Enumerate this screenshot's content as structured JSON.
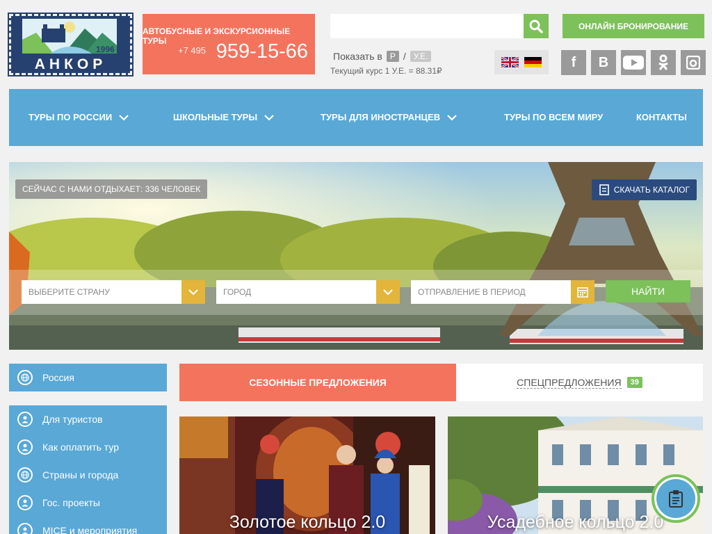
{
  "header": {
    "logo": {
      "brand": "АНКОР",
      "year": "1996"
    },
    "phone": {
      "tagline": "АВТОБУСНЫЕ И ЭКСКУРСИОННЫЕ ТУРЫ",
      "prefix": "+7 495",
      "number": "959-15-66"
    },
    "search": {
      "placeholder": ""
    },
    "currency": {
      "label": "Показать в",
      "options": [
        "Р",
        "У.Е."
      ],
      "separator": "/",
      "rate_text": "Текущий курс 1 У.Е. = 88.31₽"
    },
    "booking_button": "ОНЛАЙН БРОНИРОВАНИЕ",
    "languages": [
      "en",
      "de"
    ],
    "socials": [
      {
        "icon": "facebook-icon",
        "glyph": "f"
      },
      {
        "icon": "vkontakte-icon",
        "glyph": "В"
      },
      {
        "icon": "youtube-icon",
        "glyph": ""
      },
      {
        "icon": "odnoklassniki-icon",
        "glyph": ""
      },
      {
        "icon": "instagram-icon",
        "glyph": ""
      }
    ]
  },
  "nav": {
    "items": [
      {
        "label": "ТУРЫ ПО РОССИИ",
        "dropdown": true
      },
      {
        "label": "ШКОЛЬНЫЕ ТУРЫ",
        "dropdown": true
      },
      {
        "label": "ТУРЫ ДЛЯ ИНОСТРАНЦЕВ",
        "dropdown": true
      },
      {
        "label": "ТУРЫ ПО ВСЕМ МИРУ",
        "dropdown": false
      },
      {
        "label": "КОНТАКТЫ",
        "dropdown": false
      }
    ]
  },
  "hero": {
    "online_badge": "СЕЙЧАС С НАМИ ОТДЫХАЕТ: 336 ЧЕЛОВЕК",
    "catalog_button": "СКАЧАТЬ КАТАЛОГ",
    "filters": {
      "country_placeholder": "ВЫБЕРИТЕ СТРАНУ",
      "city_placeholder": "ГОРОД",
      "period_placeholder": "ОТПРАВЛЕНИЕ В ПЕРИОД",
      "find_button": "НАЙТИ"
    }
  },
  "sidebar": {
    "region": "Россия",
    "menu": [
      {
        "label": "Для туристов",
        "icon": "person-icon"
      },
      {
        "label": "Как оплатить тур",
        "icon": "person-icon"
      },
      {
        "label": "Страны и города",
        "icon": "globe-icon"
      },
      {
        "label": "Гос. проекты",
        "icon": "person-icon"
      },
      {
        "label": "MICE и мероприятия",
        "icon": "person-icon"
      }
    ]
  },
  "tabs": {
    "seasonal": "СЕЗОННЫЕ ПРЕДЛОЖЕНИЯ",
    "special": "СПЕЦПРЕДЛОЖЕНИЯ",
    "special_count": "39"
  },
  "cards": [
    {
      "title": "Золотое кольцо 2.0"
    },
    {
      "title": "Усадебное кольцо 2.0"
    }
  ],
  "colors": {
    "accent_blue": "#59a8d6",
    "accent_green": "#7cc15a",
    "accent_coral": "#f4735d",
    "navy": "#26416f",
    "filter_yellow": "#e3b53a"
  }
}
